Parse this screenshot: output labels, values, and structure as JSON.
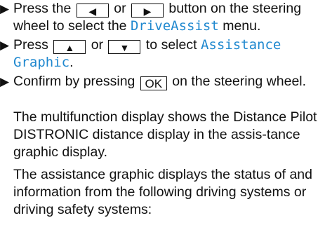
{
  "bullet_glyph": "▶",
  "step1": {
    "part1": "Press the",
    "key_left": "◀",
    "or": "or",
    "key_right": "▶",
    "part2": "button on the steering wheel to select the",
    "menu": "DriveAssist",
    "part3": "menu."
  },
  "step2": {
    "part1": "Press",
    "key_up": "▲",
    "or": "or",
    "key_down": "▼",
    "part2": "to select",
    "menu": "Assistance Graphic",
    "part3": "."
  },
  "step3": {
    "part1": "Confirm by pressing",
    "key_ok": "OK",
    "part2": "on the steering wheel."
  },
  "paragraph1": "The multifunction display shows the Distance Pilot DISTRONIC distance display in the assis-tance graphic display.",
  "paragraph2": "The assistance graphic displays the status of and information from the following driving systems or driving safety systems:",
  "colors": {
    "menu_text": "#1f88cf",
    "body_text": "#111111"
  }
}
